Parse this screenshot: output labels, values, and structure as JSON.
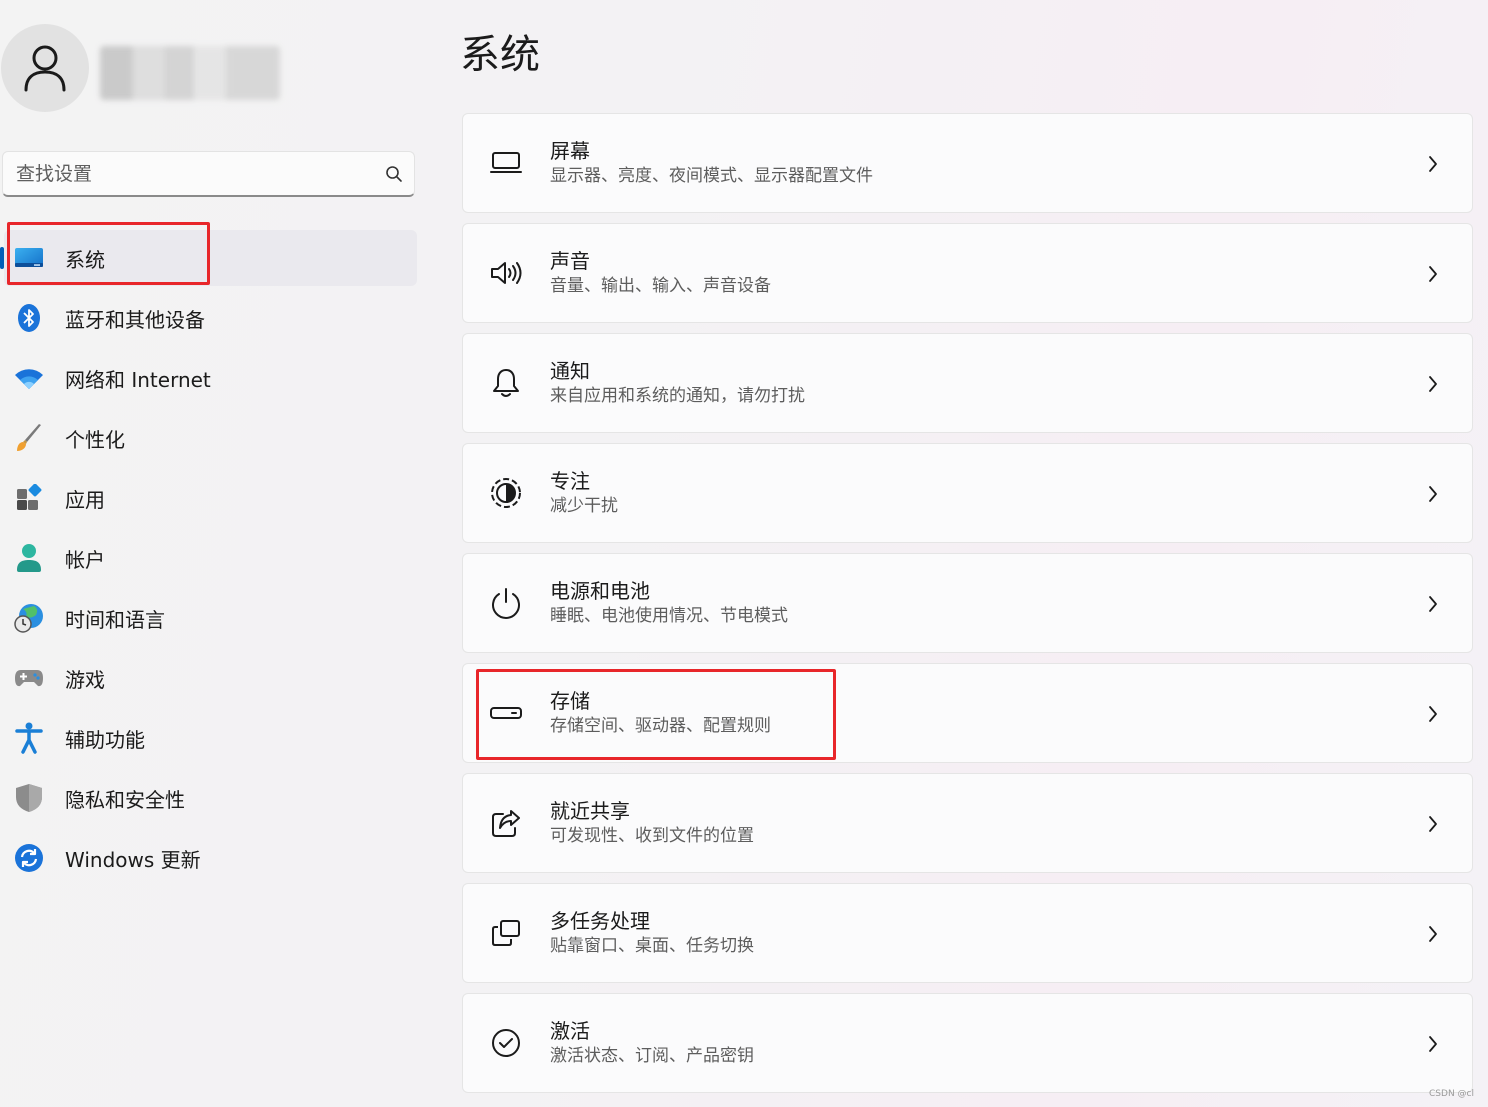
{
  "profile": {
    "avatar_icon": "person-icon"
  },
  "search": {
    "placeholder": "查找设置",
    "icon": "search-icon"
  },
  "sidebar": {
    "items": [
      {
        "label": "系统",
        "icon": "system-display-icon",
        "active": true
      },
      {
        "label": "蓝牙和其他设备",
        "icon": "bluetooth-icon"
      },
      {
        "label": "网络和 Internet",
        "icon": "wifi-icon"
      },
      {
        "label": "个性化",
        "icon": "paintbrush-icon"
      },
      {
        "label": "应用",
        "icon": "apps-icon"
      },
      {
        "label": "帐户",
        "icon": "account-icon"
      },
      {
        "label": "时间和语言",
        "icon": "globe-clock-icon"
      },
      {
        "label": "游戏",
        "icon": "gamepad-icon"
      },
      {
        "label": "辅助功能",
        "icon": "accessibility-icon"
      },
      {
        "label": "隐私和安全性",
        "icon": "shield-icon"
      },
      {
        "label": "Windows 更新",
        "icon": "update-icon"
      }
    ]
  },
  "main": {
    "title": "系统",
    "cards": [
      {
        "title": "屏幕",
        "subtitle": "显示器、亮度、夜间模式、显示器配置文件",
        "icon": "monitor-icon"
      },
      {
        "title": "声音",
        "subtitle": "音量、输出、输入、声音设备",
        "icon": "speaker-icon"
      },
      {
        "title": "通知",
        "subtitle": "来自应用和系统的通知，请勿打扰",
        "icon": "bell-icon"
      },
      {
        "title": "专注",
        "subtitle": "减少干扰",
        "icon": "focus-icon"
      },
      {
        "title": "电源和电池",
        "subtitle": "睡眠、电池使用情况、节电模式",
        "icon": "power-icon"
      },
      {
        "title": "存储",
        "subtitle": "存储空间、驱动器、配置规则",
        "icon": "storage-drive-icon"
      },
      {
        "title": "就近共享",
        "subtitle": "可发现性、收到文件的位置",
        "icon": "share-icon"
      },
      {
        "title": "多任务处理",
        "subtitle": "贴靠窗口、桌面、任务切换",
        "icon": "multitask-icon"
      },
      {
        "title": "激活",
        "subtitle": "激活状态、订阅、产品密钥",
        "icon": "check-circle-icon"
      }
    ]
  },
  "annotations": {
    "highlight_color": "#e8262a"
  },
  "colors": {
    "accent": "#005fb8"
  },
  "watermark": "CSDN @cl"
}
